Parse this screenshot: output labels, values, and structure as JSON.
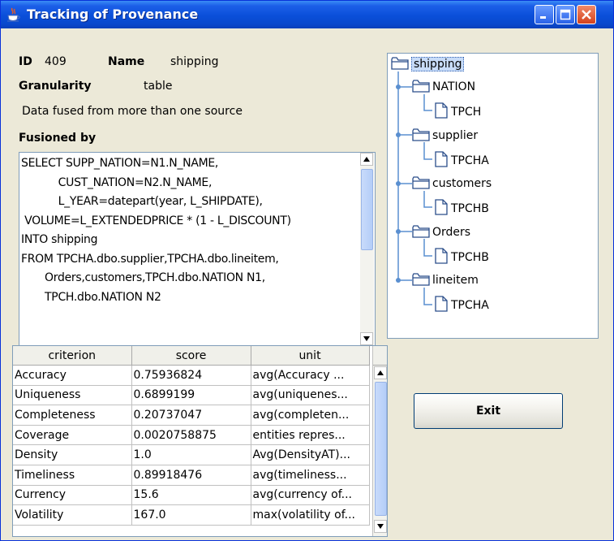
{
  "window": {
    "title": "Tracking of Provenance"
  },
  "info": {
    "id_label": "ID",
    "id_value": "409",
    "name_label": "Name",
    "name_value": "shipping",
    "granularity_label": "Granularity",
    "granularity_value": "table",
    "fused_note": "Data fused from more than one source",
    "fusioned_by_label": "Fusioned by"
  },
  "sql_lines": [
    "SELECT SUPP_NATION=N1.N_NAME,",
    "           CUST_NATION=N2.N_NAME,",
    "           L_YEAR=datepart(year, L_SHIPDATE),",
    " VOLUME=L_EXTENDEDPRICE * (1 - L_DISCOUNT)",
    "INTO shipping",
    "FROM TPCHA.dbo.supplier,TPCHA.dbo.lineitem,",
    "       Orders,customers,TPCH.dbo.NATION N1,",
    "       TPCH.dbo.NATION N2"
  ],
  "tree": {
    "root": "shipping",
    "children": [
      {
        "label": "NATION",
        "leaf": "TPCH"
      },
      {
        "label": "supplier",
        "leaf": "TPCHA"
      },
      {
        "label": "customers",
        "leaf": "TPCHB"
      },
      {
        "label": "Orders",
        "leaf": "TPCHB"
      },
      {
        "label": "lineitem",
        "leaf": "TPCHA"
      }
    ]
  },
  "table": {
    "columns": [
      "criterion",
      "score",
      "unit"
    ],
    "rows": [
      [
        "Accuracy",
        "0.75936824",
        "avg(Accuracy  ..."
      ],
      [
        "Uniqueness",
        "0.6899199",
        "avg(uniquenes..."
      ],
      [
        "Completeness",
        "0.20737047",
        "avg(completen..."
      ],
      [
        "Coverage",
        "0.0020758875",
        "entities repres..."
      ],
      [
        "Density",
        "1.0",
        "Avg(DensityAT)..."
      ],
      [
        "Timeliness",
        "0.89918476",
        "avg(timeliness..."
      ],
      [
        "Currency",
        "15.6",
        "avg(currency of..."
      ],
      [
        "Volatility",
        "167.0",
        "max(volatility of..."
      ]
    ]
  },
  "buttons": {
    "exit": "Exit"
  }
}
